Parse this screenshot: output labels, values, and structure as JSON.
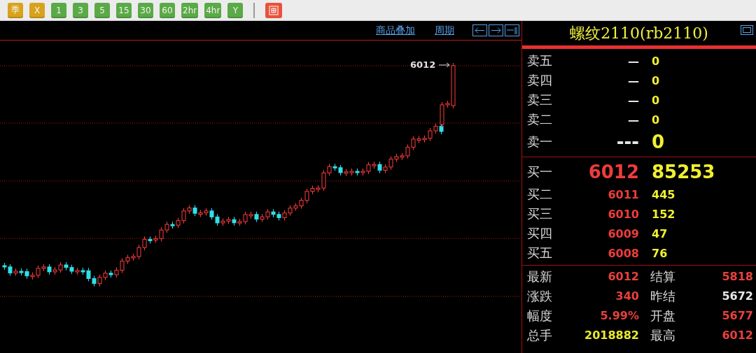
{
  "toolbar": {
    "buttons": [
      {
        "label": "季",
        "color": "#d9a21c"
      },
      {
        "label": "X",
        "color": "#d9a21c"
      },
      {
        "label": "1",
        "color": "#5aaa48"
      },
      {
        "label": "3",
        "color": "#5aaa48"
      },
      {
        "label": "5",
        "color": "#5aaa48"
      },
      {
        "label": "15",
        "color": "#5aaa48"
      },
      {
        "label": "30",
        "color": "#5aaa48"
      },
      {
        "label": "60",
        "color": "#5aaa48"
      },
      {
        "label": "2hr",
        "color": "#5aaa48"
      },
      {
        "label": "4hr",
        "color": "#5aaa48"
      },
      {
        "label": "Y",
        "color": "#5aaa48"
      }
    ]
  },
  "chart": {
    "links": [
      "商品叠加",
      "周期"
    ],
    "price_label": "6012"
  },
  "quote": {
    "title": "螺纹2110(rb2110)",
    "asks": [
      {
        "label": "卖五",
        "price": "—",
        "volume": "0"
      },
      {
        "label": "卖四",
        "price": "—",
        "volume": "0"
      },
      {
        "label": "卖三",
        "price": "—",
        "volume": "0"
      },
      {
        "label": "卖二",
        "price": "—",
        "volume": "0"
      },
      {
        "label": "卖一",
        "price": "---",
        "volume": "0",
        "kind": "best"
      }
    ],
    "bids": [
      {
        "label": "买一",
        "price": "6012",
        "volume": "85253",
        "kind": "best"
      },
      {
        "label": "买二",
        "price": "6011",
        "volume": "445",
        "kind": "level"
      },
      {
        "label": "买三",
        "price": "6010",
        "volume": "152",
        "kind": "level"
      },
      {
        "label": "买四",
        "price": "6009",
        "volume": "47",
        "kind": "level"
      },
      {
        "label": "买五",
        "price": "6008",
        "volume": "76",
        "kind": "level"
      }
    ],
    "stats": [
      {
        "label": "最新",
        "value": "6012",
        "color": "#e8403c"
      },
      {
        "label": "结算",
        "value": "5818",
        "color": "#e8403c"
      },
      {
        "label": "涨跌",
        "value": "340",
        "color": "#e8403c"
      },
      {
        "label": "昨结",
        "value": "5672",
        "color": "#e6e6e6"
      },
      {
        "label": "幅度",
        "value": "5.99%",
        "color": "#e8403c"
      },
      {
        "label": "开盘",
        "value": "5677",
        "color": "#e8403c"
      },
      {
        "label": "总手",
        "value": "2018882",
        "color": "#e8e830"
      },
      {
        "label": "最高",
        "value": "6012",
        "color": "#e8403c"
      }
    ]
  }
}
